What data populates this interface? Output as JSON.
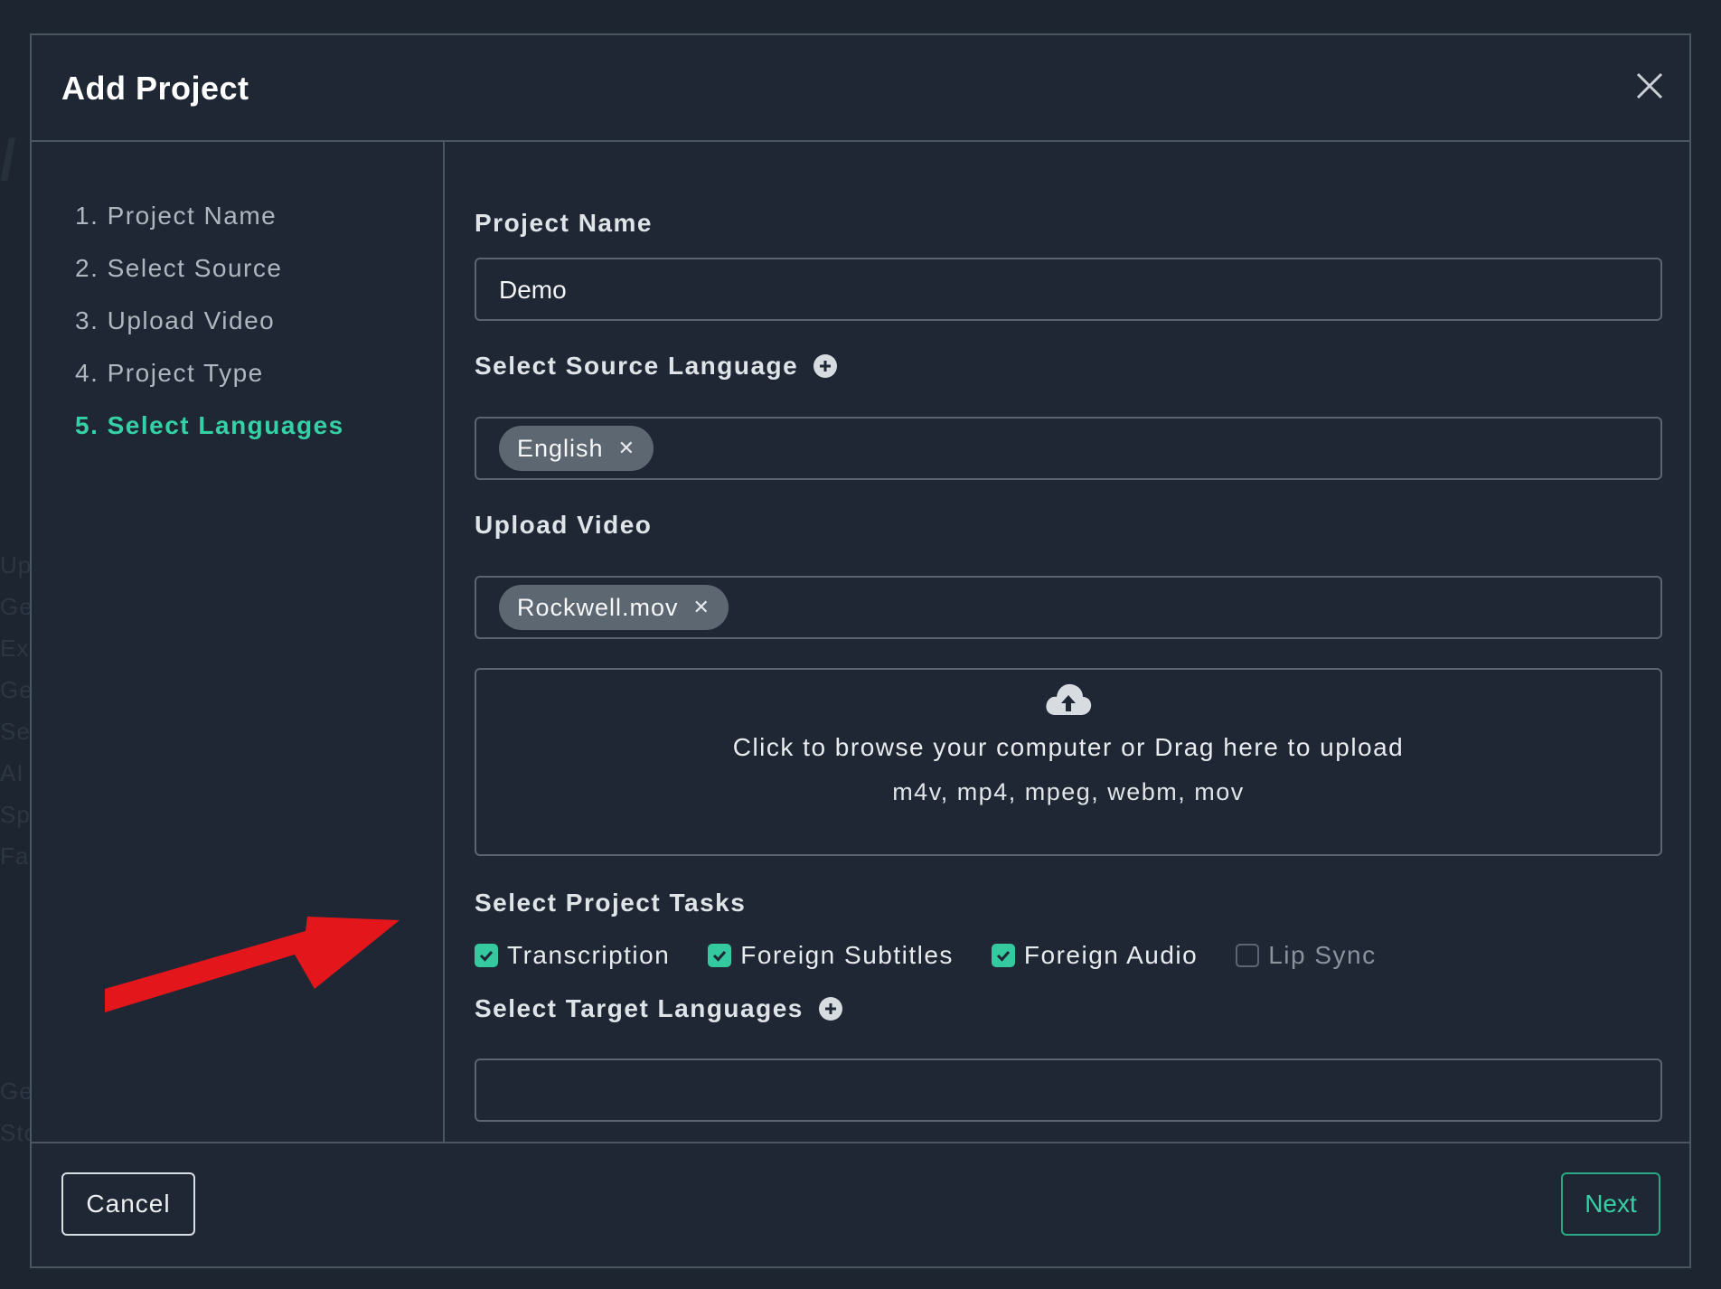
{
  "modal": {
    "title": "Add Project"
  },
  "steps": [
    {
      "label": "1. Project Name",
      "active": false
    },
    {
      "label": "2. Select Source",
      "active": false
    },
    {
      "label": "3. Upload Video",
      "active": false
    },
    {
      "label": "4. Project Type",
      "active": false
    },
    {
      "label": "5. Select Languages",
      "active": true
    }
  ],
  "form": {
    "project_name": {
      "label": "Project Name",
      "value": "Demo"
    },
    "source_language": {
      "label": "Select Source Language",
      "chip": "English"
    },
    "upload_video": {
      "label": "Upload Video",
      "chip": "Rockwell.mov",
      "dropzone_text": "Click to browse your computer or Drag here to upload",
      "formats": "m4v, mp4, mpeg, webm, mov"
    },
    "project_tasks": {
      "label": "Select Project Tasks",
      "items": [
        {
          "label": "Transcription",
          "checked": true
        },
        {
          "label": "Foreign Subtitles",
          "checked": true
        },
        {
          "label": "Foreign Audio",
          "checked": true
        },
        {
          "label": "Lip Sync",
          "checked": false
        }
      ]
    },
    "target_languages": {
      "label": "Select Target Languages",
      "value": ""
    }
  },
  "footer": {
    "cancel_label": "Cancel",
    "next_label": "Next"
  },
  "colors": {
    "accent": "#35d0a5",
    "background": "#1e2733",
    "annotation_arrow": "#e3171b"
  }
}
